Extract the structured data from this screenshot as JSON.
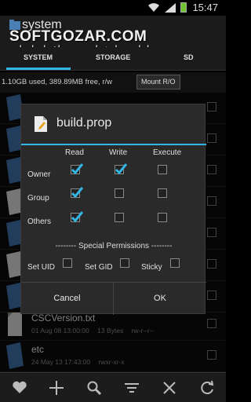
{
  "status_bar": {
    "time": "15:47"
  },
  "header": {
    "title": "system",
    "watermark_en": "SOFTGOZAR.COM",
    "watermark_fa": "اولین دانشنامه نرم افزار ایران"
  },
  "tabs": [
    {
      "label": "SYSTEM",
      "selected": true
    },
    {
      "label": "STORAGE",
      "selected": false
    },
    {
      "label": "SD",
      "selected": false
    }
  ],
  "info": {
    "free_text": "1.10GB used, 389.89MB free, r/w",
    "mount_button": "Mount R/O"
  },
  "files": [
    {
      "name": "CSCVersion.txt",
      "date": "01 Aug 08 13:00:00",
      "size": "13 Bytes",
      "perms": "rw-r--r--"
    },
    {
      "name": "etc",
      "date": "24 May 13 17:43:00",
      "size": "",
      "perms": "rwxr-xr-x"
    }
  ],
  "dialog": {
    "title": "build.prop",
    "columns": [
      "Read",
      "Write",
      "Execute"
    ],
    "rows": [
      {
        "label": "Owner",
        "read": true,
        "write": true,
        "execute": false
      },
      {
        "label": "Group",
        "read": true,
        "write": false,
        "execute": false
      },
      {
        "label": "Others",
        "read": true,
        "write": false,
        "execute": false
      }
    ],
    "special_title": "-------- Special Permissions --------",
    "special": [
      {
        "label": "Set UID",
        "checked": false
      },
      {
        "label": "Set GID",
        "checked": false
      },
      {
        "label": "Sticky",
        "checked": false
      }
    ],
    "cancel_label": "Cancel",
    "ok_label": "OK"
  },
  "colors": {
    "accent": "#33b5e5",
    "check": "#33b5e5",
    "battery": "#6ec12f"
  },
  "toolbar_icons": [
    "heart-icon",
    "plus-icon",
    "search-icon",
    "sort-icon",
    "close-icon",
    "refresh-icon"
  ]
}
